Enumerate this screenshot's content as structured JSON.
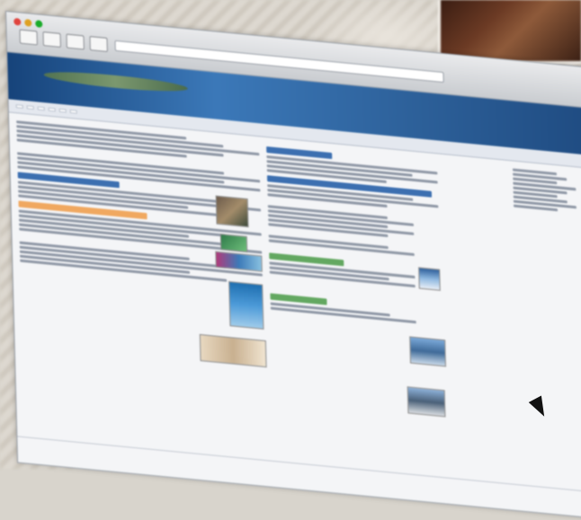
{
  "colors": {
    "banner": "#2c5f98",
    "link": "#1d4f8c",
    "bar_blue": "#3c6fb0",
    "bar_orange": "#f0a860",
    "bar_green": "#63a861"
  },
  "browser": {
    "url": "",
    "buttons": [
      "back-icon",
      "forward-icon",
      "reload-icon",
      "home-icon"
    ]
  },
  "banner": {
    "title": "",
    "subtitle": ""
  },
  "nav": {
    "items": [
      "",
      "",
      "",
      "",
      "",
      ""
    ]
  },
  "footer": {
    "text": ""
  }
}
